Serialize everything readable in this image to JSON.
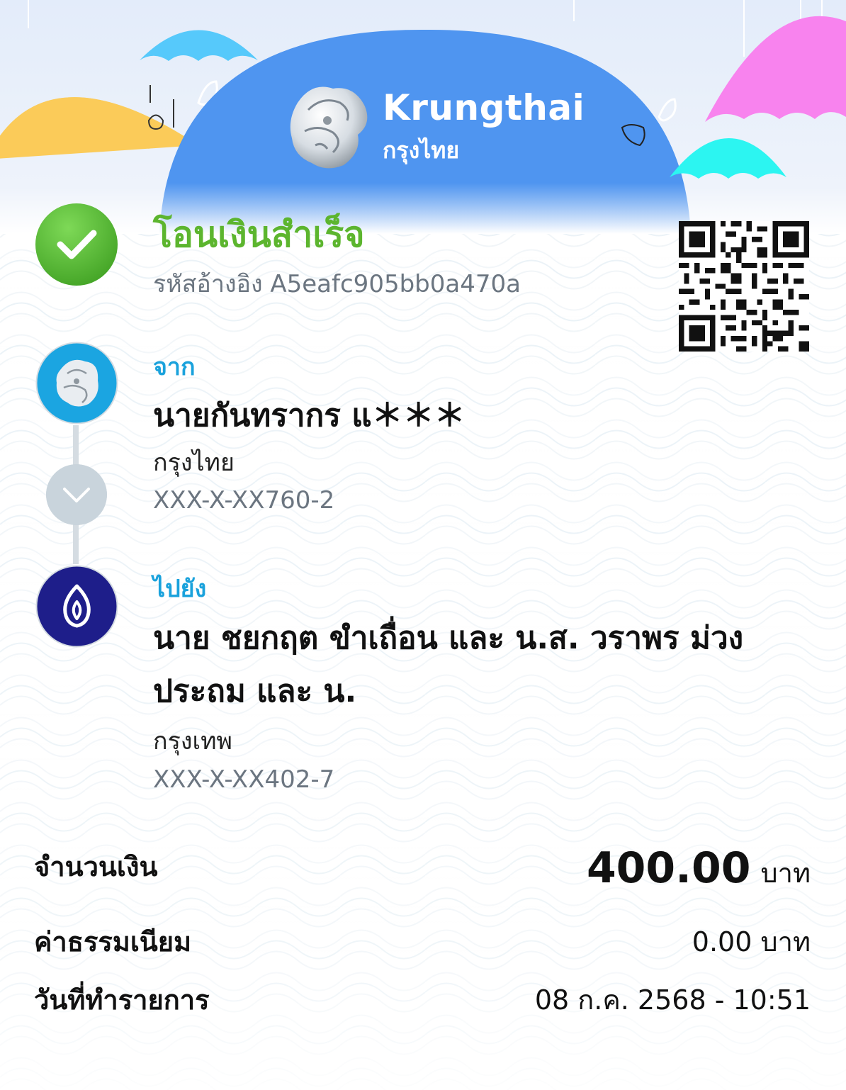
{
  "brand": {
    "name_en": "Krungthai",
    "name_th": "กรุงไทย"
  },
  "status": {
    "title": "โอนเงินสำเร็จ",
    "reference_label": "รหัสอ้างอิง",
    "reference_code": "A5eafc905bb0a470a",
    "icon": "check-icon",
    "color": "#5cb52e"
  },
  "sender": {
    "label": "จาก",
    "name": "นายกันทรากร แ＊＊＊",
    "bank": "กรุงไทย",
    "account": "XXX-X-XX760-2",
    "icon": "krungthai-logo"
  },
  "receiver": {
    "label": "ไปยัง",
    "name_line1": "นาย ชยกฤต ขำเถื่อน และ น.ส. วราพร ม่วง",
    "name_line2": "ประถม และ น.",
    "bank": "กรุงเทพ",
    "account": "XXX-X-XX402-7",
    "icon": "bangkok-bank-logo"
  },
  "details": {
    "amount_label": "จำนวนเงิน",
    "amount_value": "400.00",
    "amount_unit": "บาท",
    "fee_label": "ค่าธรรมเนียม",
    "fee_value": "0.00 บาท",
    "date_label": "วันที่ทำรายการ",
    "date_value": "08 ก.ค. 2568 - 10:51"
  },
  "colors": {
    "accent_blue": "#1aa2dc",
    "hero_blue": "#4f95f0",
    "bbl_navy": "#1e1e8a"
  }
}
